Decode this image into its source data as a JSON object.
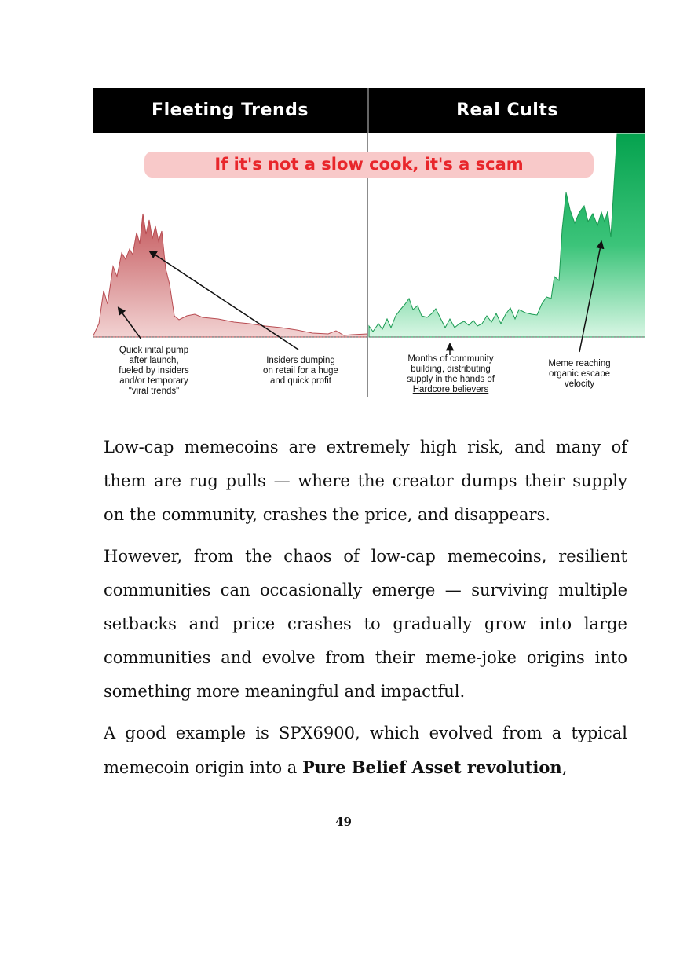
{
  "figure": {
    "left_title": "Fleeting Trends",
    "right_title": "Real Cults",
    "banner": "If it's not a slow cook, it's a scam",
    "captions": {
      "pump": "Quick inital pump\nafter launch,\nfueled by insiders\nand/or temporary\n\"viral trends\"",
      "dump": "Insiders dumping\non retail for a huge\nand quick profit",
      "community_line1": "Months of community\nbuilding, distributing\nsupply in the hands of",
      "community_line2": "Hardcore believers",
      "escape": "Meme reaching\norganic escape\nvelocity"
    },
    "colors": {
      "header_bg": "#000000",
      "banner_bg": "#f8c9c9",
      "banner_text": "#e8262b",
      "red_area": "#c4585c",
      "green_area": "#1faa5a"
    }
  },
  "body": {
    "paragraph1": "Low-cap memecoins are extremely high risk, and many of them are rug pulls — where the creator dumps their supply on the community, crashes the price, and disappears.",
    "paragraph2": "However, from the chaos of low-cap memecoins, resilient communities can occasionally emerge — surviving multiple setbacks and price crashes to gradually grow into large communities and evolve from their meme-joke origins into something more meaningful and impactful.",
    "paragraph3_start": "A good example is SPX6900, which evolved from a typical memecoin origin into a ",
    "paragraph3_bold": "Pure Belief Asset revolution",
    "paragraph3_end": ","
  },
  "page_number": "49"
}
